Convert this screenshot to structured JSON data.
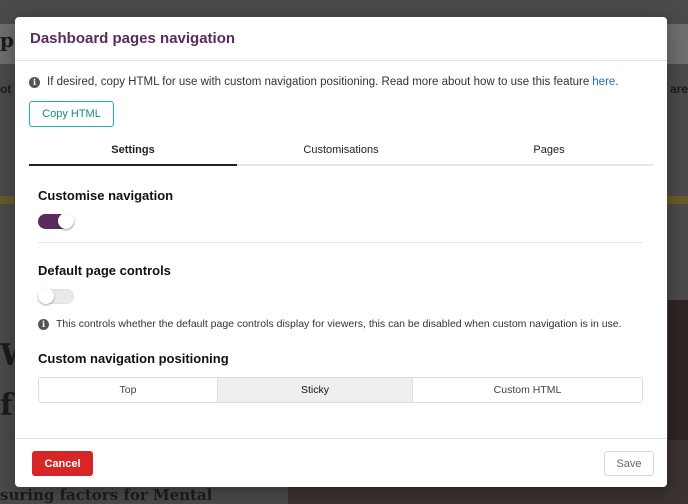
{
  "background": {
    "left_fragments": [
      "pa",
      "ot",
      "W",
      "f"
    ],
    "right_fragment": "are",
    "bottom_text": "suring factors for Mental"
  },
  "modal": {
    "title": "Dashboard pages navigation",
    "info_text": "If desired, copy HTML for use with custom navigation positioning. Read more about how to use this feature",
    "info_link": "here",
    "info_suffix": ".",
    "copy_button": "Copy HTML",
    "tabs": [
      {
        "label": "Settings",
        "active": true
      },
      {
        "label": "Customisations",
        "active": false
      },
      {
        "label": "Pages",
        "active": false
      }
    ],
    "customise_navigation": {
      "label": "Customise navigation",
      "enabled": true
    },
    "default_page_controls": {
      "label": "Default page controls",
      "enabled": false
    },
    "help_text": "This controls whether the default page controls display for viewers, this can be disabled when custom navigation is in use.",
    "positioning": {
      "label": "Custom navigation positioning",
      "options": [
        "Top",
        "Sticky",
        "Custom HTML"
      ],
      "selected": "Sticky"
    },
    "cancel_button": "Cancel",
    "save_button": "Save"
  },
  "colors": {
    "title": "#5b2a5f",
    "toggle_on": "#5b2a5f",
    "copy_button_accent": "#1fb3ab",
    "cancel_button": "#d62626",
    "link": "#1a6fb0"
  },
  "icons": {
    "info": "info-circle-icon"
  }
}
